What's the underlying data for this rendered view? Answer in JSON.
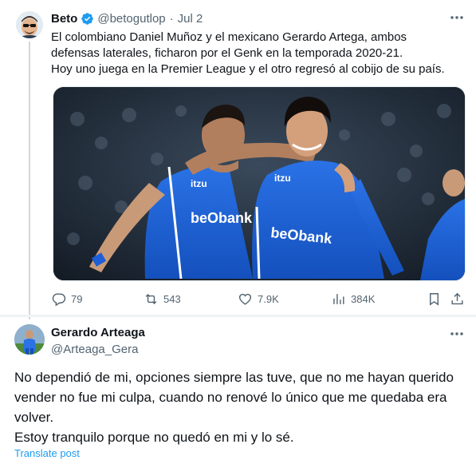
{
  "quoted_tweet": {
    "author_name": "Beto",
    "author_handle": "@betogutlop",
    "separator": "·",
    "date": "Jul 2",
    "text_lines": [
      "El colombiano Daniel Muñoz y el mexicano Gerardo Artega, ambos",
      "defensas laterales, ficharon por el Genk en la temporada 2020-21.",
      "Hoy uno juega en la Premier League y el otro regresó al cobijo de su país."
    ],
    "media": {
      "jersey_sponsor_left": "beObank",
      "jersey_sponsor_right": "beObank",
      "kit_brand": "itzu"
    },
    "stats": {
      "replies": "79",
      "reposts": "543",
      "likes": "7.9K",
      "views": "384K"
    }
  },
  "reply_tweet": {
    "author_name": "Gerardo Arteaga",
    "author_handle": "@Arteaga_Gera",
    "text_lines": [
      "No dependió de mi, opciones siempre las tuve, que no me hayan querido",
      "vender no fue mi culpa, cuando no renové lo único que me quedaba era",
      "volver.",
      "Estoy tranquilo porque no quedó en mi y lo sé."
    ],
    "translate_label": "Translate post"
  },
  "colors": {
    "accent": "#1d9bf0",
    "muted": "#536471",
    "text": "#0f1419",
    "genk_blue": "#1c5fd6"
  }
}
